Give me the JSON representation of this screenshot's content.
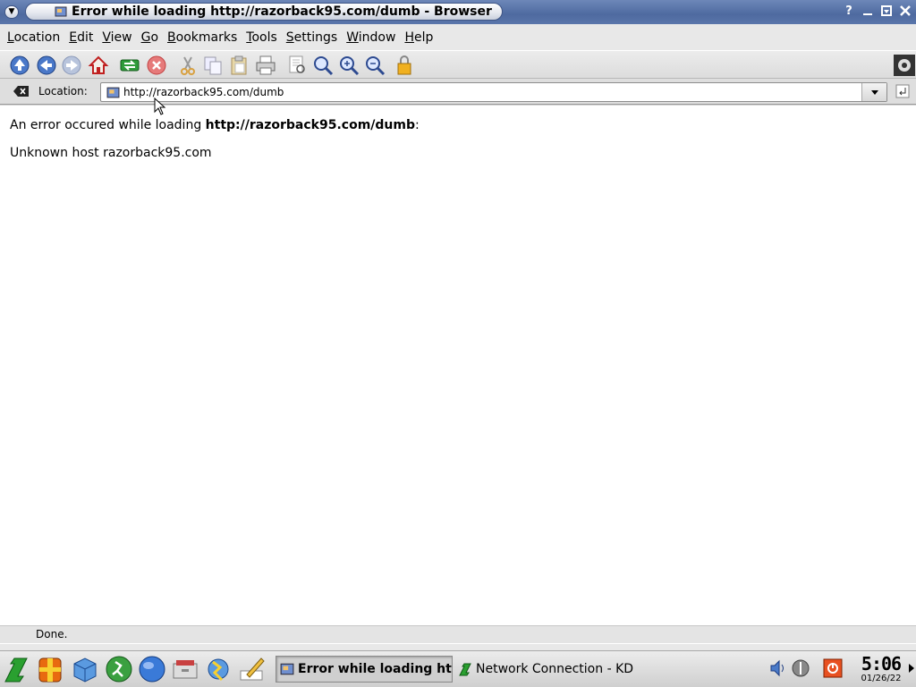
{
  "window": {
    "title": "Error while loading http://razorback95.com/dumb - Browser",
    "buttons": [
      "help",
      "minimize",
      "maximize",
      "close"
    ]
  },
  "menubar": {
    "items": [
      {
        "label": "Location",
        "mnemonic": "L"
      },
      {
        "label": "Edit",
        "mnemonic": "E"
      },
      {
        "label": "View",
        "mnemonic": "V"
      },
      {
        "label": "Go",
        "mnemonic": "G"
      },
      {
        "label": "Bookmarks",
        "mnemonic": "B"
      },
      {
        "label": "Tools",
        "mnemonic": "T"
      },
      {
        "label": "Settings",
        "mnemonic": "S"
      },
      {
        "label": "Window",
        "mnemonic": "W"
      },
      {
        "label": "Help",
        "mnemonic": "H"
      }
    ]
  },
  "toolbar": {
    "icons": [
      "up-icon",
      "back-icon",
      "forward-icon",
      "home-icon",
      "reload-icon",
      "stop-icon",
      "cut-icon",
      "copy-icon",
      "paste-icon",
      "print-icon",
      "print-preview-icon",
      "zoom-icon",
      "zoom-in-icon",
      "zoom-out-icon",
      "lock-icon",
      "throbber-icon"
    ]
  },
  "location": {
    "label": "Location:",
    "url": "http://razorback95.com/dumb"
  },
  "content": {
    "error_prefix": "An error occured while loading ",
    "error_url": "http://razorback95.com/dumb",
    "error_suffix": ":",
    "error_detail": "Unknown host razorback95.com"
  },
  "status": {
    "text": "Done."
  },
  "panel": {
    "tasks": [
      {
        "label": "Error while loading http:",
        "active": true
      },
      {
        "label": "Network Connection - KD",
        "active": false
      }
    ],
    "clock": {
      "time": "5:06",
      "date": "01/26/22"
    }
  },
  "colors": {
    "titlebar": "#5a75aa",
    "page_bg": "#ffffff",
    "chrome_bg": "#e8e8e8"
  }
}
